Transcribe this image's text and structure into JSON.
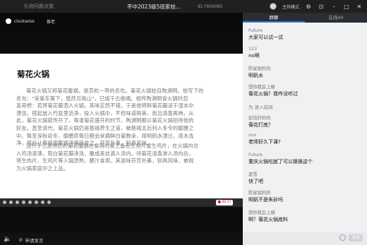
{
  "titlebar": {
    "left_link": "礼物问题点我",
    "title": "平中2023级5班家校...",
    "room_id": "ID:7606085",
    "host_mode": "主持模式"
  },
  "stage": {
    "brand": "clockwise",
    "nav": "推老"
  },
  "slide": {
    "title": "菊花火锅",
    "p1_lines": [
      "菊花火锅又称菊花暖锅，是苏杭一带的名吃。菊花火锅始自陶渊明，他写下的",
      "名句：\"采菊东篱下，悠然见南山\"，已成千古绝唱。相传陶渊明食火锅时忽",
      "发奇想：若将菊花瓣洒入火锅，其味定然不错。于是他将鲜菊花瓣浸于湿水中",
      "漂洗，搭起放入竹篮里沥净，投入火锅中，不但味道鲜美，而且清香爽神。从",
      "此，菊花火锅就传开了，每逢菊花盛开的时节，陶渊明都以菊花火锅招待他的",
      "好友。直至清代，菊花火锅仍是慈禧养生之道，被慈禧太后列入冬令的御膳之",
      "中。每至深秋初冬，御膳房每日都会呆摘鲜白菊数朵，用明矾水漂过，清水洗",
      "净，然后让慈禧用暖锅汤涮而食之，芬芳扑鼻，别具风味。"
    ],
    "p2_lines": [
      "流行于江浙地区的菊花暖锅在食用时桌上备有生鱼片或生鸡片，在火锅内兑",
      "入鸡汤滚沸，取白菊花瓣净洗，撒成差丝滴入汤内。待菊花清香渗入汤内后，",
      "将生肉片、生鸡片等入锅烫熟，蘸汁食用，其滋味芬芳扑鼻，别具风味，被视",
      "为火锅家庭中之上品。"
    ],
    "rec_label": "■ 00:17"
  },
  "bottom": {
    "mic_label": "申请发言"
  },
  "chat": {
    "tabs": [
      "群聊",
      "在线40"
    ],
    "messages": [
      {
        "name": "Future",
        "text": "大家可以试一试"
      },
      {
        "name": "123",
        "text": "no啊"
      },
      {
        "name": "陈星宸妈妈",
        "text": "明矾水"
      },
      {
        "name": "想你我会上瘾",
        "text": "菊花火锅？我咋没听过"
      },
      {
        "name": "",
        "text": "为 进入房间"
      },
      {
        "name": "彭钰轩妈妈",
        "text": "菊花打底？"
      },
      {
        "name": "xxx",
        "text": "老师好久下课?"
      },
      {
        "name": "Future",
        "text": "重庆火锅吃腻了可以换换这个"
      },
      {
        "name": "夏雪",
        "text": "快了吧"
      },
      {
        "name": "陈星宸妈妈",
        "text": "明矾不是朱砂吗"
      },
      {
        "name": "想你我会上瘾",
        "text": "啊？菊花火锅底料"
      }
    ],
    "send_label": "发送"
  }
}
